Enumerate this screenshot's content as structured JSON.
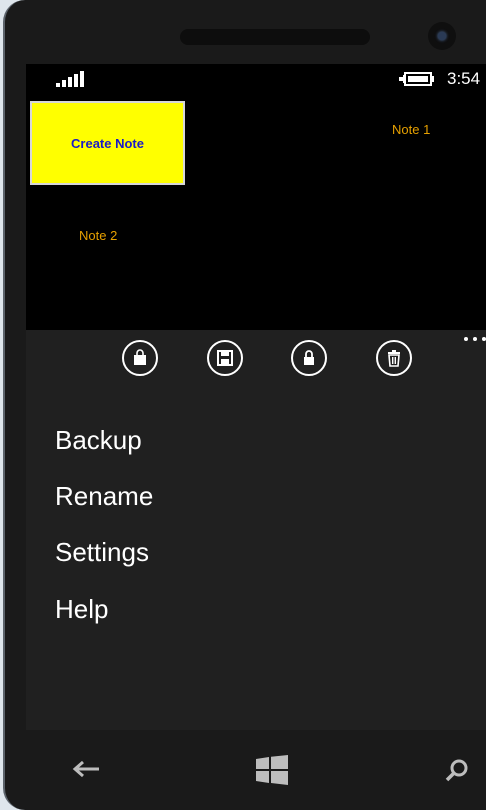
{
  "status": {
    "time": "3:54"
  },
  "tiles": {
    "create_note": "Create Note",
    "notes": [
      "Note 1",
      "Note 2"
    ]
  },
  "app_bar": {
    "buttons": [
      {
        "icon": "shopping-bag-icon",
        "label": ""
      },
      {
        "icon": "save-icon",
        "label": ""
      },
      {
        "icon": "lock-icon",
        "label": ""
      },
      {
        "icon": "trash-icon",
        "label": ""
      }
    ],
    "menu": [
      "Backup",
      "Rename",
      "Settings",
      "Help"
    ]
  },
  "nav": {
    "buttons": [
      "back-arrow-icon",
      "windows-logo-icon",
      "search-icon"
    ]
  },
  "colors": {
    "tile_background": "#ffff00",
    "tile_text": "#1a1ac8",
    "note_text": "#e6a000",
    "screen_background": "#000000",
    "app_bar_background": "#202020"
  }
}
